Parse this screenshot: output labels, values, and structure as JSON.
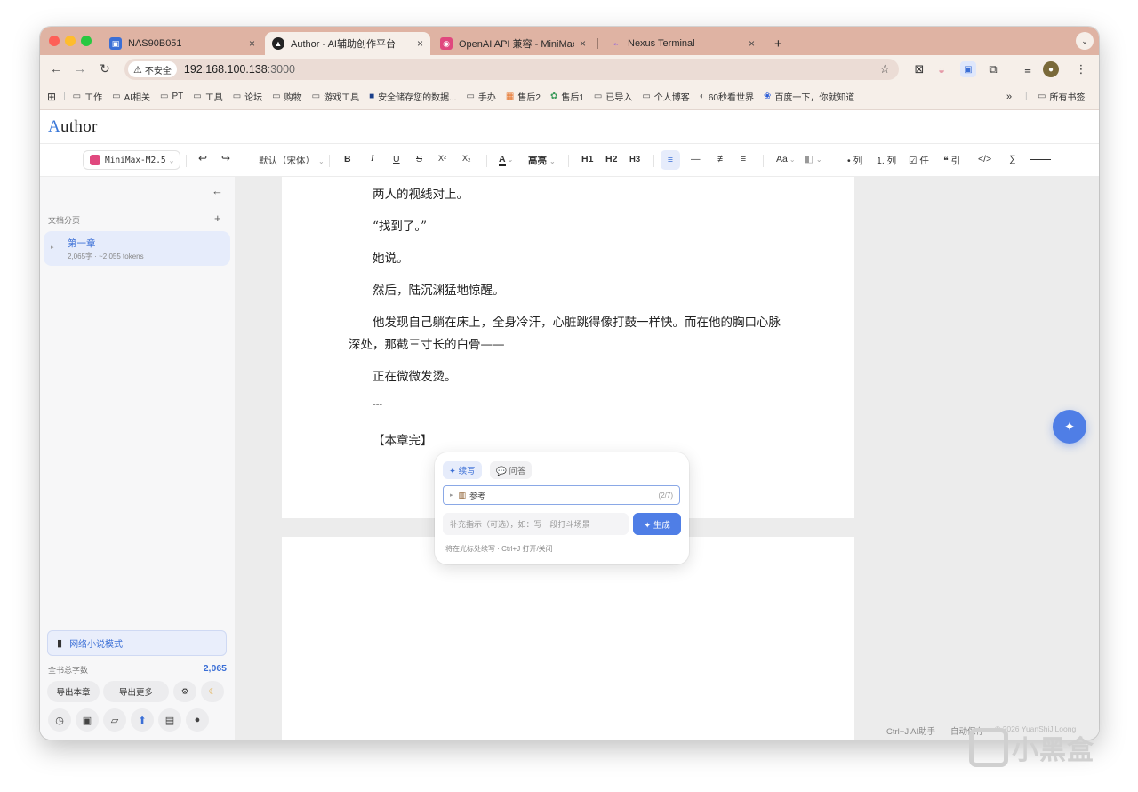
{
  "browser": {
    "tabs": [
      {
        "title": "NAS90B051",
        "close": "×",
        "fav_color": "#3b6fd6",
        "icon": "nas-icon"
      },
      {
        "title": "Author - AI辅助创作平台",
        "close": "×",
        "fav_color": "#222222",
        "icon": "author-icon"
      },
      {
        "title": "OpenAI API 兼容 - MiniMax 开",
        "close": "×",
        "fav_color": "#e0487e",
        "icon": "minimax-icon"
      },
      {
        "title": "Nexus Terminal",
        "close": "×",
        "fav_color": "#9b6bd6",
        "icon": "nexus-icon"
      }
    ],
    "new_tab": "+",
    "security_label": "不安全",
    "url_host": "192.168.100.138",
    "url_port": ":3000",
    "bookmarks": [
      {
        "label": "工作",
        "icon": "folder-icon"
      },
      {
        "label": "AI相关",
        "icon": "folder-icon"
      },
      {
        "label": "PT",
        "icon": "folder-icon"
      },
      {
        "label": "工具",
        "icon": "folder-icon"
      },
      {
        "label": "论坛",
        "icon": "folder-icon"
      },
      {
        "label": "购物",
        "icon": "folder-icon"
      },
      {
        "label": "游戏工具",
        "icon": "folder-icon"
      },
      {
        "label": "安全储存您的数据...",
        "icon": "storage-icon"
      },
      {
        "label": "手办",
        "icon": "folder-icon"
      },
      {
        "label": "售后2",
        "icon": "windows-icon"
      },
      {
        "label": "售后1",
        "icon": "ubuntu-icon"
      },
      {
        "label": "已导入",
        "icon": "folder-icon"
      },
      {
        "label": "个人博客",
        "icon": "folder-icon"
      },
      {
        "label": "60秒看世界",
        "icon": "news-icon"
      },
      {
        "label": "百度一下，你就知道",
        "icon": "baidu-icon"
      }
    ],
    "bookmarks_more": "»",
    "all_bookmarks": "所有书签"
  },
  "app": {
    "logo_first": "A",
    "logo_rest": "uthor"
  },
  "toolbar": {
    "model": "MiniMax-M2.5",
    "font": "默认（宋体）",
    "bold": "B",
    "italic": "I",
    "underline": "U",
    "strike": "S",
    "superscript": "X²",
    "subscript": "X₂",
    "font_color": "A",
    "highlight": "高亮",
    "h1": "H1",
    "h2": "H2",
    "h3": "H3",
    "font_size": "Aa",
    "bullet_list": "• 列",
    "ordered_list": "1. 列",
    "task_list": "☑ 任",
    "quote": "❝ 引",
    "code": "</>",
    "math": "∑",
    "accent_color": "#3b6fd6"
  },
  "sidebar": {
    "section_title": "文档分页",
    "add": "+",
    "chapter_title": "第一章",
    "chapter_meta": "2,065字 · ~2,055 tokens",
    "novel_mode": "网络小说模式",
    "total_label": "全书总字数",
    "total_count": "2,065",
    "export_chapter": "导出本章",
    "export_more": "导出更多"
  },
  "editor": {
    "paragraphs": [
      "两人的视线对上。",
      "“找到了。”",
      "她说。",
      "然后，陆沉渊猛地惊醒。",
      "他发现自己躺在床上，全身冷汗，心脏跳得像打鼓一样快。而在他的胸口心脉",
      "深处，那截三寸长的白骨——",
      "正在微微发烫。",
      "---",
      "【本章完】"
    ]
  },
  "ai_popup": {
    "tab_write": "✦ 续写",
    "tab_qa": "💬 问答",
    "reference_label": "参考",
    "reference_count": "(2/7)",
    "input_placeholder": "补充指示（可选），如：写一段打斗场景",
    "generate": "✦ 生成",
    "hint": "将在光标处续写 · Ctrl+J 打开/关闭"
  },
  "statusbar": {
    "shortcut": "Ctrl+J AI助手",
    "autosave": "自动保存",
    "copyright": "© 2026 YuanShiJiLoong"
  },
  "watermark": {
    "text": "小黑盒"
  }
}
